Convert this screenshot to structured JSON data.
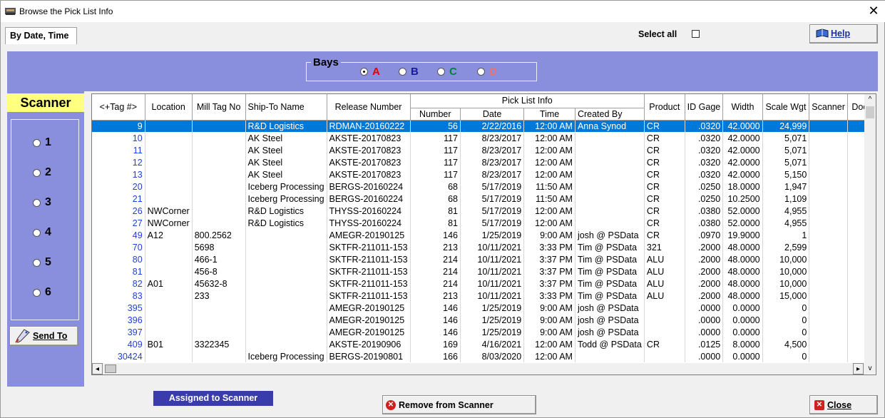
{
  "window": {
    "title": "Browse the Pick List Info",
    "close_glyph": "✕"
  },
  "tab": {
    "label": "By Date, Time"
  },
  "select_all": {
    "label": "Select all",
    "checked": false
  },
  "help": {
    "label": "Help",
    "icon": "help-book-icon"
  },
  "bays": {
    "title": "Bays",
    "options": [
      {
        "label": "A",
        "color": "#e00000",
        "selected": true
      },
      {
        "label": "B",
        "color": "#1a1aa0",
        "selected": false
      },
      {
        "label": "C",
        "color": "#008040",
        "selected": false
      },
      {
        "label": "D",
        "color": "#f07070",
        "selected": false
      }
    ]
  },
  "scanner": {
    "title": "Scanner",
    "options": [
      "1",
      "2",
      "3",
      "4",
      "5",
      "6"
    ],
    "send_to_label": "Send To",
    "send_icon": "scanner-gun-icon"
  },
  "grid": {
    "headers": {
      "tag": "<+Tag #>",
      "location": "Location",
      "mill_tag": "Mill Tag No",
      "ship_to": "Ship-To Name",
      "release": "Release Number",
      "pick_list_info": "Pick List Info",
      "number": "Number",
      "date": "Date",
      "time": "Time",
      "created_by": "Created By",
      "product": "Product",
      "id_gage": "ID Gage",
      "width": "Width",
      "scale_wgt": "Scale Wgt",
      "scanner": "Scanner",
      "door": "Door"
    },
    "rows": [
      [
        "9",
        "",
        "",
        "R&D Logistics",
        "RDMAN-20160222",
        "56",
        "2/22/2016",
        "12:00 AM",
        "Anna Synod",
        "CR",
        ".0320",
        "42.0000",
        "24,999",
        "",
        ""
      ],
      [
        "10",
        "",
        "",
        "AK Steel",
        "AKSTE-20170823",
        "117",
        "8/23/2017",
        "12:00 AM",
        "",
        "CR",
        ".0320",
        "42.0000",
        "5,071",
        "",
        ""
      ],
      [
        "11",
        "",
        "",
        "AK Steel",
        "AKSTE-20170823",
        "117",
        "8/23/2017",
        "12:00 AM",
        "",
        "CR",
        ".0320",
        "42.0000",
        "5,071",
        "",
        ""
      ],
      [
        "12",
        "",
        "",
        "AK Steel",
        "AKSTE-20170823",
        "117",
        "8/23/2017",
        "12:00 AM",
        "",
        "CR",
        ".0320",
        "42.0000",
        "5,071",
        "",
        ""
      ],
      [
        "13",
        "",
        "",
        "AK Steel",
        "AKSTE-20170823",
        "117",
        "8/23/2017",
        "12:00 AM",
        "",
        "CR",
        ".0320",
        "42.0000",
        "5,150",
        "",
        ""
      ],
      [
        "20",
        "",
        "",
        "Iceberg Processing",
        "BERGS-20160224",
        "68",
        "5/17/2019",
        "11:50 AM",
        "",
        "CR",
        ".0250",
        "18.0000",
        "1,947",
        "",
        ""
      ],
      [
        "21",
        "",
        "",
        "Iceberg Processing",
        "BERGS-20160224",
        "68",
        "5/17/2019",
        "11:50 AM",
        "",
        "CR",
        ".0250",
        "10.2500",
        "1,109",
        "",
        ""
      ],
      [
        "26",
        "NWCorner",
        "",
        "R&D Logistics",
        "THYSS-20160224",
        "81",
        "5/17/2019",
        "12:00 AM",
        "",
        "CR",
        ".0380",
        "52.0000",
        "4,955",
        "",
        ""
      ],
      [
        "27",
        "NWCorner",
        "",
        "R&D Logistics",
        "THYSS-20160224",
        "81",
        "5/17/2019",
        "12:00 AM",
        "",
        "CR",
        ".0380",
        "52.0000",
        "4,955",
        "",
        ""
      ],
      [
        "49",
        "A12",
        "800.2562",
        "",
        "AMEGR-20190125",
        "146",
        "1/25/2019",
        "9:00 AM",
        "josh @ PSData",
        "CR",
        ".0970",
        "19.9000",
        "1",
        "",
        ""
      ],
      [
        "70",
        "",
        "5698",
        "",
        "SKTFR-211011-153",
        "213",
        "10/11/2021",
        "3:33 PM",
        "Tim @ PSData",
        "321",
        ".2000",
        "48.0000",
        "2,599",
        "",
        ""
      ],
      [
        "80",
        "",
        "466-1",
        "",
        "SKTFR-211011-153",
        "214",
        "10/11/2021",
        "3:37 PM",
        "Tim @ PSData",
        "ALU",
        ".2000",
        "48.0000",
        "10,000",
        "",
        ""
      ],
      [
        "81",
        "",
        "456-8",
        "",
        "SKTFR-211011-153",
        "214",
        "10/11/2021",
        "3:37 PM",
        "Tim @ PSData",
        "ALU",
        ".2000",
        "48.0000",
        "10,000",
        "",
        ""
      ],
      [
        "82",
        "A01",
        "45632-8",
        "",
        "SKTFR-211011-153",
        "214",
        "10/11/2021",
        "3:37 PM",
        "Tim @ PSData",
        "ALU",
        ".2000",
        "48.0000",
        "10,000",
        "",
        ""
      ],
      [
        "83",
        "",
        "233",
        "",
        "SKTFR-211011-153",
        "213",
        "10/11/2021",
        "3:33 PM",
        "Tim @ PSData",
        "ALU",
        ".2000",
        "48.0000",
        "15,000",
        "",
        ""
      ],
      [
        "395",
        "",
        "",
        "",
        "AMEGR-20190125",
        "146",
        "1/25/2019",
        "9:00 AM",
        "josh @ PSData",
        "",
        ".0000",
        "0.0000",
        "0",
        "",
        ""
      ],
      [
        "396",
        "",
        "",
        "",
        "AMEGR-20190125",
        "146",
        "1/25/2019",
        "9:00 AM",
        "josh @ PSData",
        "",
        ".0000",
        "0.0000",
        "0",
        "",
        ""
      ],
      [
        "397",
        "",
        "",
        "",
        "AMEGR-20190125",
        "146",
        "1/25/2019",
        "9:00 AM",
        "josh @ PSData",
        "",
        ".0000",
        "0.0000",
        "0",
        "",
        ""
      ],
      [
        "409",
        "B01",
        "3322345",
        "",
        "AKSTE-20190906",
        "169",
        "4/16/2021",
        "12:00 AM",
        "Todd @ PSData",
        "CR",
        ".0125",
        "8.0000",
        "4,500",
        "",
        ""
      ],
      [
        "30424",
        "",
        "",
        "Iceberg Processing",
        "BERGS-20190801",
        "166",
        "8/03/2020",
        "12:00 AM",
        "",
        "",
        ".0000",
        "0.0000",
        "0",
        "",
        ""
      ]
    ],
    "selected_row": 0
  },
  "footer": {
    "assigned_label": "Assigned to Scanner",
    "remove_label": "Remove from Scanner",
    "close_label": "Close"
  }
}
